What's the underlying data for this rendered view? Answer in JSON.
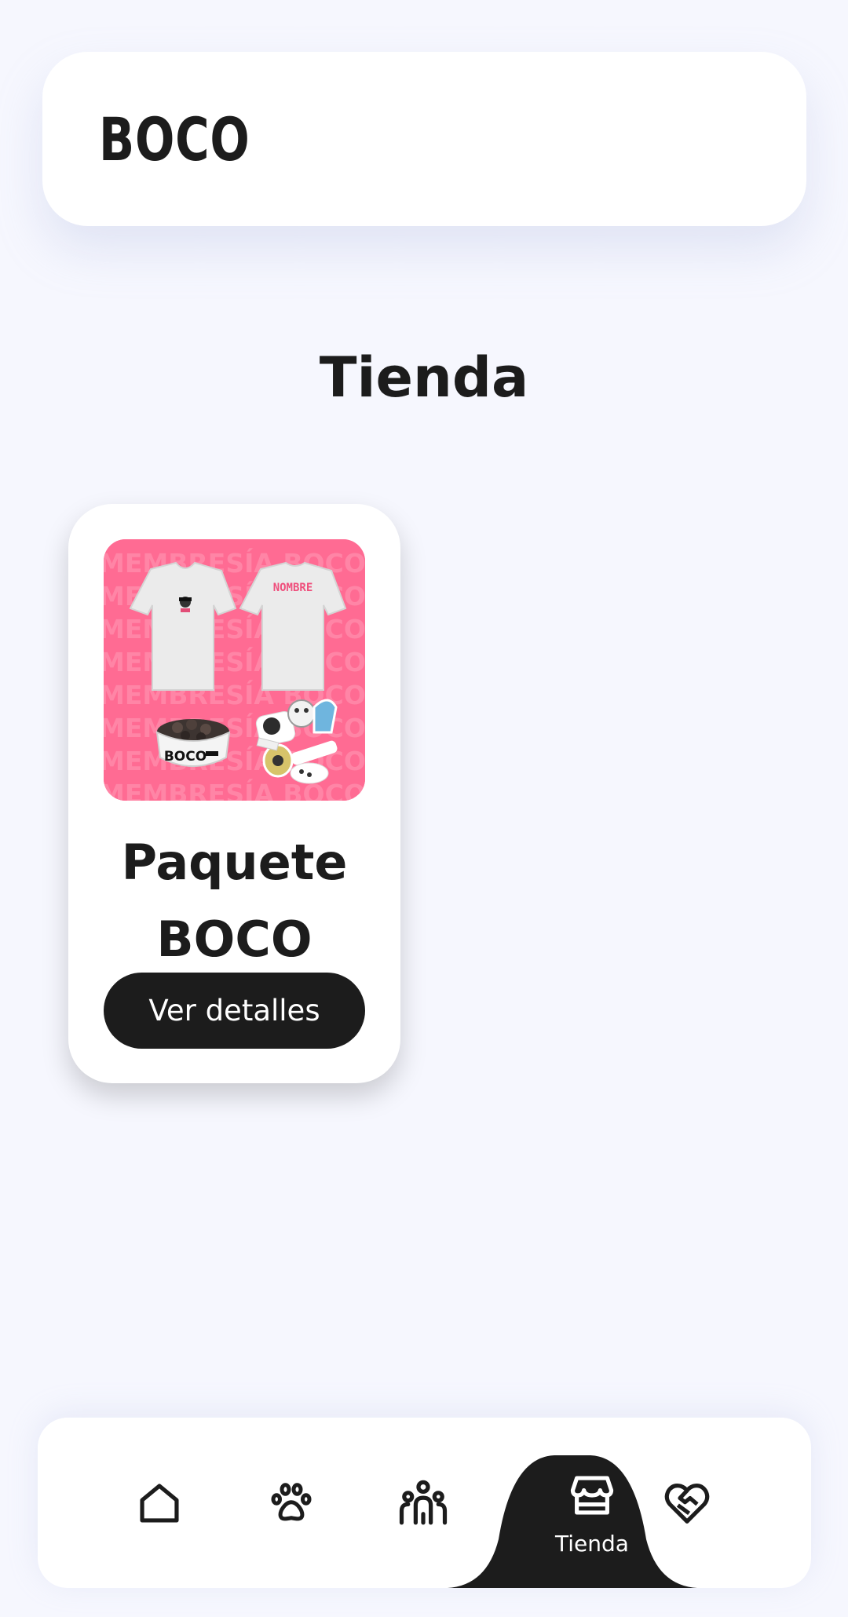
{
  "header": {
    "logo_text": "BOCO"
  },
  "page": {
    "title": "Tienda"
  },
  "products": [
    {
      "name_line1": "Paquete",
      "name_line2": "BOCO",
      "button_label": "Ver detalles",
      "image": {
        "background_color": "#ff6b93",
        "pattern_text": "MEMBRESÍA BOCO",
        "shirt_back_text": "NOMBRE",
        "bowl_text": "BOCO"
      }
    }
  ],
  "bottom_nav": {
    "items": [
      {
        "icon": "home-icon"
      },
      {
        "icon": "paw-icon"
      },
      {
        "icon": "community-icon"
      },
      {
        "icon": "store-icon",
        "label": "Tienda",
        "active": true
      },
      {
        "icon": "heart-handshake-icon"
      }
    ],
    "active_color": "#1c1c1c"
  }
}
